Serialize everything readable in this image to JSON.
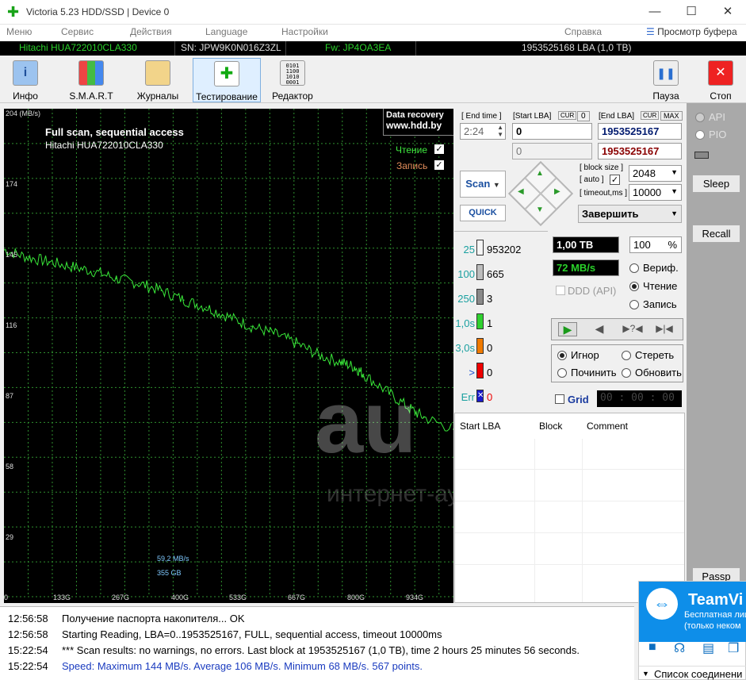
{
  "window": {
    "title": "Victoria 5.23 HDD/SSD | Device 0",
    "min": "—",
    "max": "☐",
    "close": "✕"
  },
  "menu": {
    "items": [
      "Меню",
      "Сервис",
      "Действия",
      "Language",
      "Настройки"
    ],
    "help": "Справка",
    "buffer": "Просмотр буфера"
  },
  "drive": {
    "model": "Hitachi HUA722010CLA330",
    "sn": "SN: JPW9K0N016Z3ZL",
    "fw": "Fw: JP4OA3EA",
    "lba": "1953525168 LBA (1,0 TB)"
  },
  "toolbar": {
    "info": "Инфо",
    "smart": "S.M.A.R.T",
    "logs": "Журналы",
    "test": "Тестирование",
    "editor": "Редактор",
    "pause": "Пауза",
    "stop": "Стоп"
  },
  "graph": {
    "title": "Full scan, sequential access",
    "subtitle": "Hitachi HUA722010CLA330",
    "banner1": "Data recovery",
    "banner2": "www.hdd.by",
    "read": "Чтение",
    "write": "Запись",
    "speed": "59,2 MB/s",
    "size": "355 GB"
  },
  "chart_data": {
    "type": "line",
    "ylabel": "MB/s",
    "yticks": [
      "204 (MB/s)",
      "174",
      "145",
      "116",
      "87",
      "58",
      "29"
    ],
    "xticks": [
      "0",
      "133G",
      "267G",
      "400G",
      "533G",
      "667G",
      "800G",
      "934G"
    ],
    "ylim": [
      0,
      204
    ],
    "xlim": [
      0,
      1000
    ],
    "series": [
      {
        "name": "Чтение",
        "color": "#39e839",
        "x": [
          0,
          50,
          100,
          150,
          200,
          250,
          300,
          350,
          400,
          450,
          500,
          550,
          600,
          650,
          700,
          750,
          780,
          800,
          850,
          900,
          934,
          1000
        ],
        "y": [
          145,
          142,
          140,
          138,
          136,
          133,
          131,
          128,
          124,
          121,
          117,
          113,
          110,
          106,
          101,
          98,
          96,
          93,
          86,
          79,
          75,
          70
        ]
      }
    ]
  },
  "controls": {
    "end_time_lbl": "[ End time ]",
    "start_lba_lbl": "[Start LBA]",
    "cur": "CUR",
    "cur_val": "0",
    "end_lba_lbl": "[End LBA]",
    "max": "MAX",
    "time": "2:24",
    "start_lba": "0",
    "end_lba": "1953525167",
    "start_lba2": "0",
    "end_lba2": "1953525167",
    "scan": "Scan",
    "quick": "QUICK",
    "block_size": "[ block size ]",
    "auto": "[ auto ]",
    "timeout": "[ timeout,ms ]",
    "bs_val": "2048",
    "to_val": "10000",
    "finish": "Завершить"
  },
  "blocks": [
    {
      "label": "25",
      "count": "953202",
      "color": "#f5f5f5"
    },
    {
      "label": "100",
      "count": "665",
      "color": "#bdbdbd"
    },
    {
      "label": "250",
      "count": "3",
      "color": "#8a8a8a"
    },
    {
      "label": "1,0s",
      "count": "1",
      "color": "#2fd12f"
    },
    {
      "label": "3,0s",
      "count": "0",
      "color": "#f07a00"
    },
    {
      "label": ">",
      "count": "0",
      "color": "#ee0000"
    },
    {
      "label": "Err",
      "count": "0",
      "color": "#1a1acc"
    }
  ],
  "stats": {
    "size": "1,00 TB",
    "pct": "100",
    "pct_sign": "%",
    "speed": "72 MB/s",
    "ddd": "DDD (API)",
    "verify": "Вериф.",
    "read": "Чтение",
    "write": "Запись",
    "ignore": "Игнор",
    "erase": "Стереть",
    "repair": "Починить",
    "refresh": "Обновить",
    "grid": "Grid",
    "timer": "00 : 00 : 00"
  },
  "table": {
    "h1": "Start LBA",
    "h2": "Block",
    "h3": "Comment"
  },
  "side": {
    "api": "API",
    "pio": "PIO",
    "sleep": "Sleep",
    "recall": "Recall",
    "passp": "Passp"
  },
  "log": [
    {
      "t": "12:56:58",
      "m": "Получение паспорта накопителя... OK",
      "c": "#000"
    },
    {
      "t": "12:56:58",
      "m": "Starting Reading, LBA=0..1953525167, FULL, sequential access, timeout 10000ms",
      "c": "#000"
    },
    {
      "t": "15:22:54",
      "m": "*** Scan results: no warnings, no errors. Last block at 1953525167 (1,0 TB), time 2 hours 25 minutes 56 seconds.",
      "c": "#000"
    },
    {
      "t": "15:22:54",
      "m": "Speed: Maximum 144 MB/s. Average 106 MB/s. Minimum 68 MB/s. 567 points.",
      "c": "#1a3bbf"
    }
  ],
  "teamviewer": {
    "name": "TeamVi",
    "line1": "Бесплатная лиц",
    "line2": "(только неком",
    "list": "Список соединени"
  },
  "watermark": {
    "big": "au",
    "small": "интернет-аукцион"
  }
}
